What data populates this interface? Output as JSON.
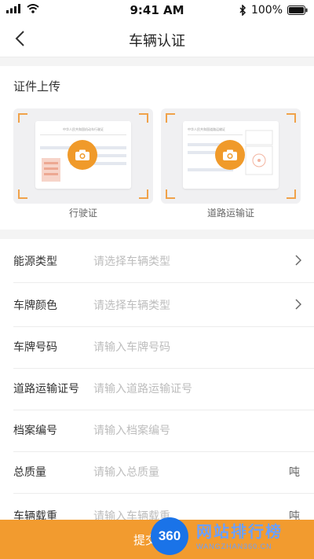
{
  "status_bar": {
    "time": "9:41 AM",
    "battery": "100%"
  },
  "nav": {
    "title": "车辆认证"
  },
  "upload": {
    "title": "证件上传",
    "docs": [
      {
        "label": "行驶证",
        "paper_title": "中华人民共和国机动车行驶证"
      },
      {
        "label": "道路运输证",
        "paper_title": "中华人民共和国道路运输证"
      }
    ]
  },
  "form": {
    "rows": [
      {
        "label": "能源类型",
        "placeholder": "请选择车辆类型",
        "has_arrow": true
      },
      {
        "label": "车牌颜色",
        "placeholder": "请选择车辆类型",
        "has_arrow": true
      },
      {
        "label": "车牌号码",
        "placeholder": "请输入车牌号码"
      },
      {
        "label": "道路运输证号",
        "placeholder": "请输入道路运输证号"
      },
      {
        "label": "档案编号",
        "placeholder": "请输入档案编号"
      },
      {
        "label": "总质量",
        "placeholder": "请输入总质量",
        "unit": "吨"
      },
      {
        "label": "车辆载重",
        "placeholder": "请输入车辆载重",
        "unit": "吨"
      }
    ]
  },
  "submit": {
    "label": "提交认证"
  },
  "watermark": {
    "logo": "360",
    "title": "网站排行榜",
    "subtitle": "WANGZHAN360.CN"
  },
  "colors": {
    "accent": "#f29b2f",
    "camera": "#f09a2a",
    "corner": "#f0a24a"
  }
}
